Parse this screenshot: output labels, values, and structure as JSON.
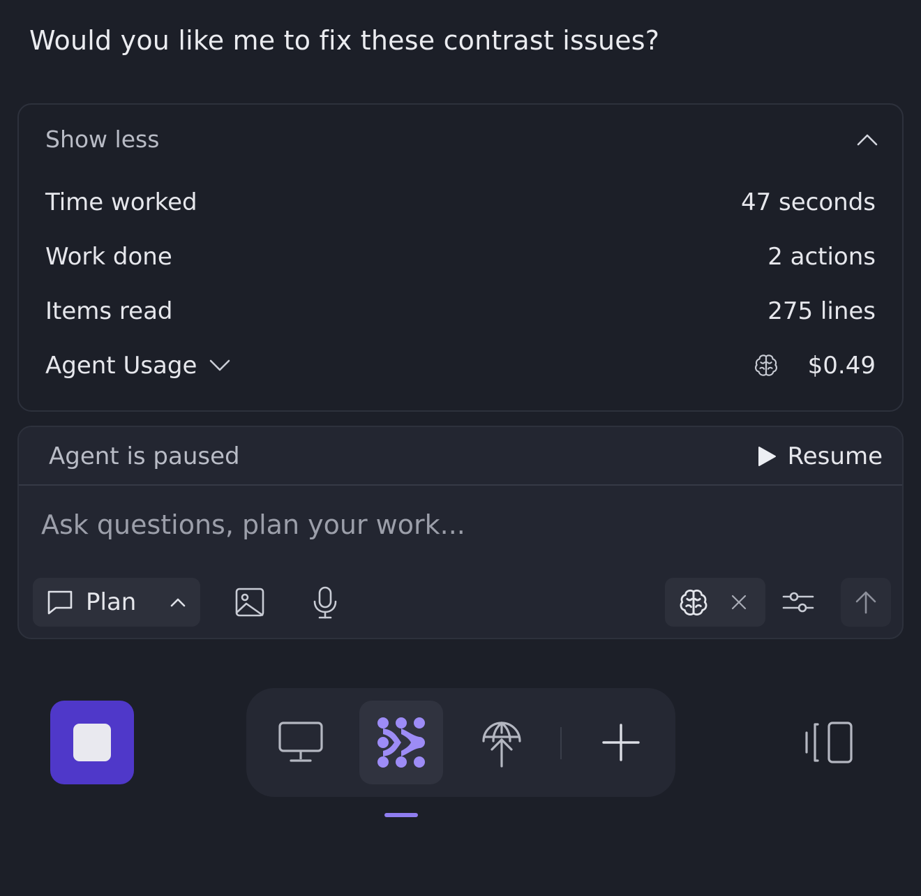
{
  "message": {
    "text": "Would you like me to fix these contrast issues?"
  },
  "summary": {
    "toggle_label": "Show less",
    "rows": [
      {
        "label": "Time worked",
        "value": "47 seconds"
      },
      {
        "label": "Work done",
        "value": "2 actions"
      },
      {
        "label": "Items read",
        "value": "275 lines"
      },
      {
        "label": "Agent Usage",
        "value": "$0.49"
      }
    ]
  },
  "composer": {
    "status_text": "Agent is paused",
    "resume_label": "Resume",
    "input_placeholder": "Ask questions, plan your work...",
    "input_value": "",
    "mode_label": "Plan"
  },
  "icons": {
    "collapse": "chevron-up-icon",
    "usage_expand": "chevron-down-icon",
    "usage": "brain-icon",
    "resume": "play-icon",
    "mode": "chat-bubble-icon",
    "image": "image-icon",
    "voice": "microphone-icon",
    "model": "brain-icon",
    "remove": "close-icon",
    "settings": "sliders-icon",
    "send": "arrow-up-icon",
    "stop": "stop-icon",
    "dock": [
      "monitor-icon",
      "agent-icon",
      "deploy-icon",
      "plus-icon"
    ],
    "panel": "panel-toggle-icon"
  },
  "colors": {
    "background": "#1c1f28",
    "accent": "#4f38c9",
    "accent_light": "#8f7df0"
  }
}
